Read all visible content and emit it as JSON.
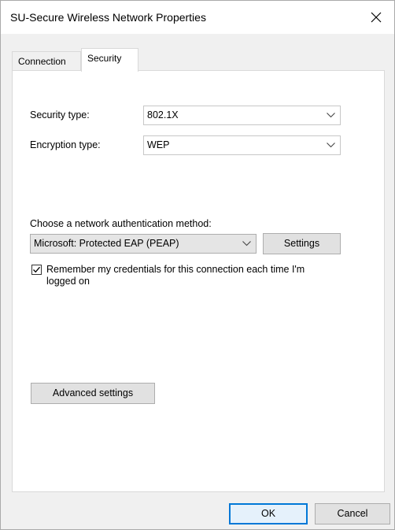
{
  "window": {
    "title": "SU-Secure Wireless Network Properties"
  },
  "tabs": [
    {
      "label": "Connection",
      "active": false
    },
    {
      "label": "Security",
      "active": true
    }
  ],
  "security": {
    "security_type_label": "Security type:",
    "security_type_value": "802.1X",
    "encryption_type_label": "Encryption type:",
    "encryption_type_value": "WEP",
    "auth_method_label": "Choose a network authentication method:",
    "auth_method_value": "Microsoft: Protected EAP (PEAP)",
    "settings_button": "Settings",
    "remember_checked": true,
    "remember_label": "Remember my credentials for this connection each time I'm logged on",
    "advanced_button": "Advanced settings"
  },
  "footer": {
    "ok_button": "OK",
    "cancel_button": "Cancel"
  },
  "icons": {
    "close": "close-icon",
    "chevron": "chevron-down-icon",
    "check": "checkmark-icon"
  },
  "colors": {
    "accent": "#0078d7",
    "window_bg": "#f0f0f0",
    "panel_bg": "#ffffff"
  }
}
